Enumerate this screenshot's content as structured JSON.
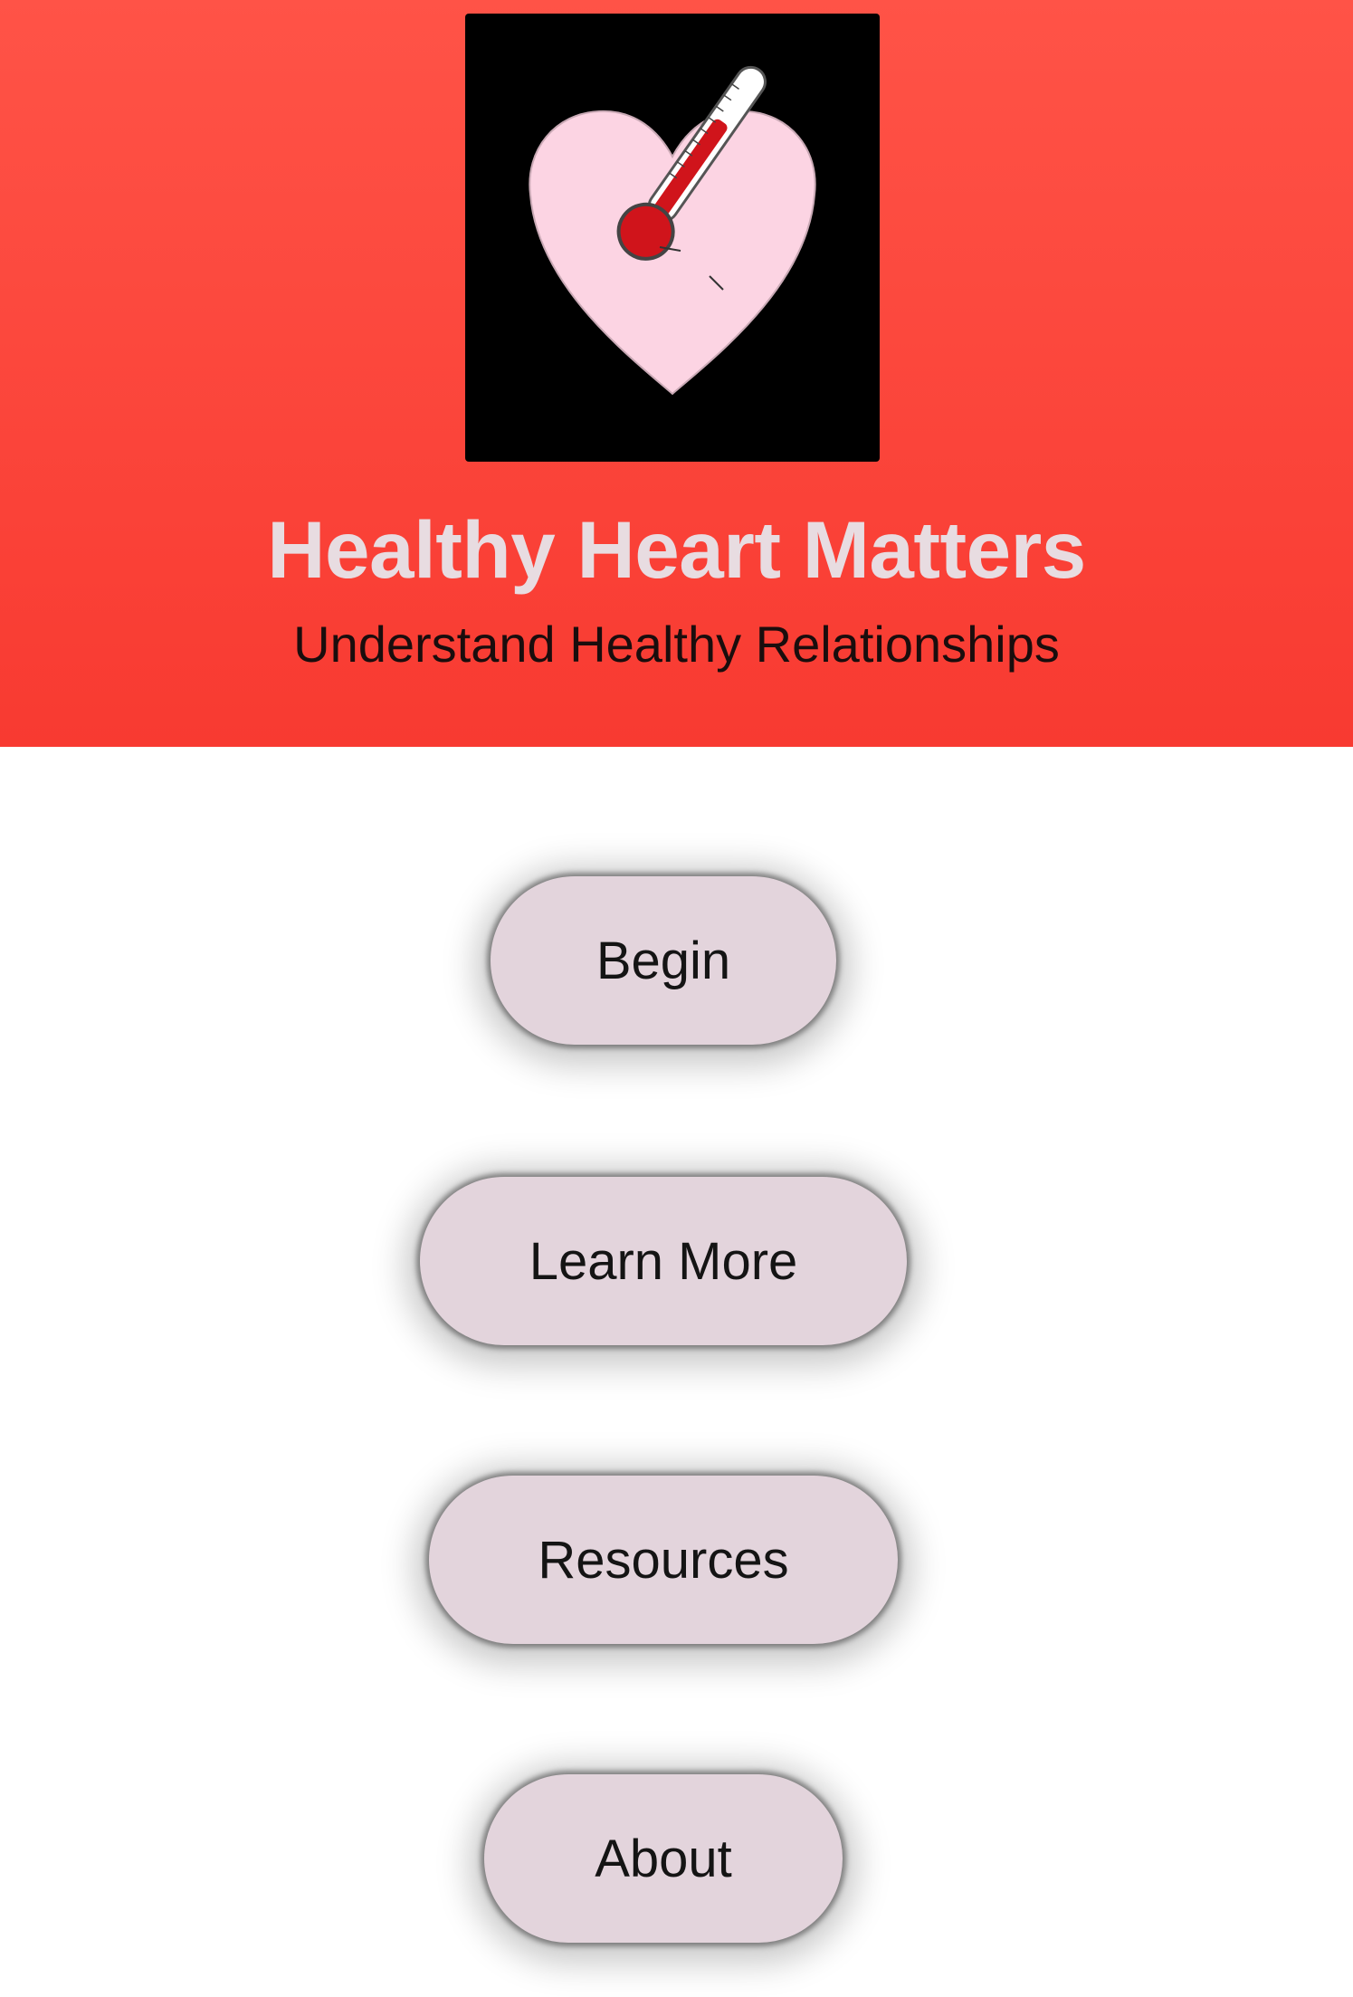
{
  "app": {
    "title": "Healthy Heart Matters",
    "subtitle": "Understand Healthy Relationships",
    "logo_icon": "heart-thermometer-icon"
  },
  "menu": {
    "items": [
      {
        "label": "Begin"
      },
      {
        "label": "Learn More"
      },
      {
        "label": "Resources"
      },
      {
        "label": "About"
      }
    ]
  },
  "colors": {
    "header_gradient_top": "#ff5347",
    "header_gradient_bottom": "#f83a31",
    "title_text": "#e8dce1",
    "button_fill": "#e3d4dc",
    "heart_fill": "#fcd4e3",
    "thermometer_red": "#d0141b"
  }
}
